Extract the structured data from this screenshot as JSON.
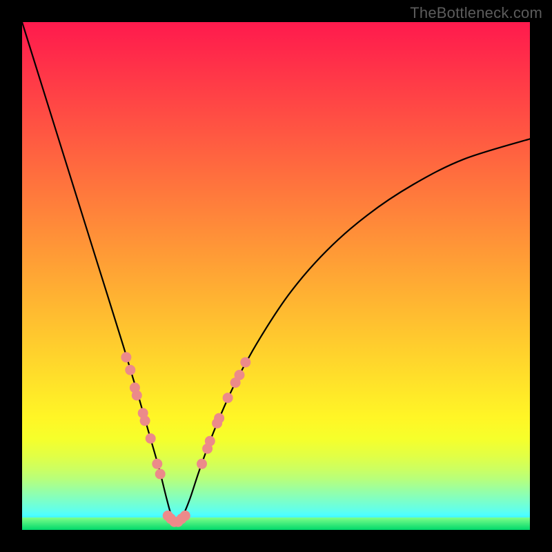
{
  "watermark": "TheBottleneck.com",
  "chart_data": {
    "type": "line",
    "title": "",
    "xlabel": "",
    "ylabel": "",
    "xlim": [
      0,
      100
    ],
    "ylim": [
      0,
      100
    ],
    "grid": false,
    "legend": false,
    "series": [
      {
        "name": "bottleneck-curve",
        "x": [
          0,
          5,
          10,
          15,
          20,
          23,
          25,
          27,
          28.5,
          29.5,
          30.3,
          31.5,
          33,
          35,
          38,
          42,
          47,
          53,
          60,
          68,
          77,
          87,
          100
        ],
        "y": [
          100,
          84,
          68,
          52,
          36,
          26,
          19,
          12,
          6,
          2.5,
          1.2,
          2.5,
          6,
          12,
          20,
          29,
          38,
          47,
          55,
          62,
          68,
          73,
          77
        ]
      }
    ],
    "markers": {
      "name": "highlight-dots",
      "color": "#ec8a8a",
      "points": [
        {
          "x": 20.5,
          "y": 34
        },
        {
          "x": 21.3,
          "y": 31.5
        },
        {
          "x": 22.2,
          "y": 28
        },
        {
          "x": 22.6,
          "y": 26.5
        },
        {
          "x": 23.8,
          "y": 23
        },
        {
          "x": 24.2,
          "y": 21.5
        },
        {
          "x": 25.3,
          "y": 18
        },
        {
          "x": 26.6,
          "y": 13
        },
        {
          "x": 27.2,
          "y": 11
        },
        {
          "x": 28.7,
          "y": 2.8
        },
        {
          "x": 29.3,
          "y": 2.2
        },
        {
          "x": 30.0,
          "y": 1.6
        },
        {
          "x": 30.7,
          "y": 1.6
        },
        {
          "x": 31.4,
          "y": 2.2
        },
        {
          "x": 32.1,
          "y": 2.8
        },
        {
          "x": 35.4,
          "y": 13
        },
        {
          "x": 36.5,
          "y": 16
        },
        {
          "x": 37.0,
          "y": 17.5
        },
        {
          "x": 38.4,
          "y": 21
        },
        {
          "x": 38.8,
          "y": 22
        },
        {
          "x": 40.5,
          "y": 26
        },
        {
          "x": 42.0,
          "y": 29
        },
        {
          "x": 42.8,
          "y": 30.5
        },
        {
          "x": 44.0,
          "y": 33
        }
      ]
    },
    "optimum_x": 30.3,
    "background": {
      "type": "vertical-gradient",
      "stops": [
        {
          "pos": 0.0,
          "color": "#ff1a4d"
        },
        {
          "pos": 0.5,
          "color": "#ffa135"
        },
        {
          "pos": 0.78,
          "color": "#fff626"
        },
        {
          "pos": 0.98,
          "color": "#00e68a"
        }
      ]
    }
  }
}
